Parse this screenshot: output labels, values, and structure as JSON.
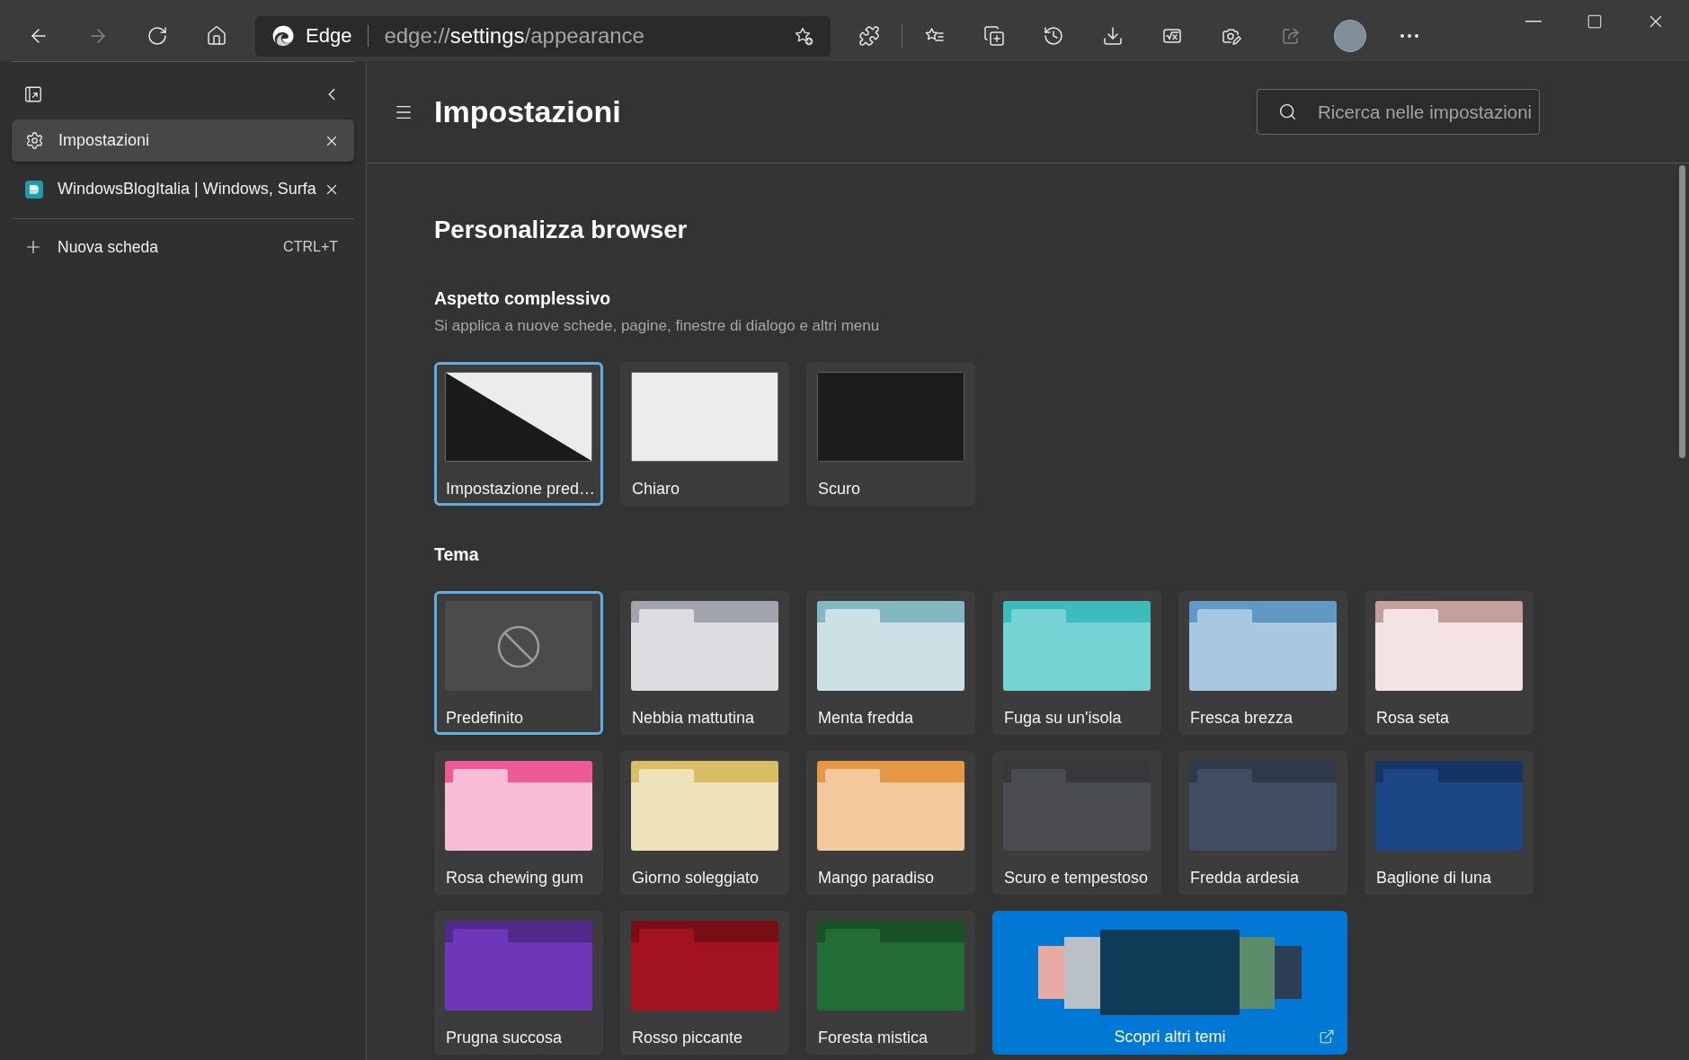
{
  "toolbar": {
    "nav_buttons": [
      {
        "kind": "back",
        "disabled": false
      },
      {
        "kind": "forward",
        "disabled": true
      },
      {
        "kind": "refresh",
        "disabled": false
      },
      {
        "kind": "home",
        "disabled": false
      }
    ],
    "address_bar": {
      "site_label": "Edge",
      "url": {
        "scheme": "edge://",
        "host": "settings",
        "path": "/appearance"
      }
    },
    "button_groups": [
      [
        {
          "kind": "extensions",
          "disabled": false
        }
      ],
      [
        {
          "kind": "favorites",
          "disabled": false
        },
        {
          "kind": "collections",
          "disabled": false
        },
        {
          "kind": "history",
          "disabled": false
        },
        {
          "kind": "downloads",
          "disabled": false
        },
        {
          "kind": "math",
          "disabled": false
        },
        {
          "kind": "capture",
          "disabled": false
        },
        {
          "kind": "share",
          "disabled": true
        },
        {
          "kind": "profile",
          "disabled": false
        },
        {
          "kind": "more",
          "disabled": false
        }
      ]
    ],
    "window_controls": [
      {
        "kind": "minimize"
      },
      {
        "kind": "maximize"
      },
      {
        "kind": "close"
      }
    ]
  },
  "sidebar": {
    "tabs": [
      {
        "kind": "settings",
        "title": "Impostazioni",
        "selected": true
      },
      {
        "kind": "site",
        "title": "WindowsBlogItalia | Windows, Surfa",
        "selected": false
      }
    ],
    "new_tab": {
      "label": "Nuova scheda",
      "shortcut": "CTRL+T"
    }
  },
  "settings": {
    "title": "Impostazioni",
    "search": {
      "placeholder": "Ricerca nelle impostazioni"
    },
    "section_title": "Personalizza browser",
    "appearance": {
      "heading": "Aspetto complessivo",
      "description": "Si applica a nuove schede, pagine, finestre di dialogo e altri menu",
      "options": [
        {
          "kind": "system",
          "label": "Impostazione pred…",
          "selected": true
        },
        {
          "kind": "light",
          "label": "Chiaro",
          "selected": false
        },
        {
          "kind": "dark",
          "label": "Scuro",
          "selected": false
        }
      ]
    },
    "theme": {
      "heading": "Tema",
      "themes": [
        {
          "kind": "none",
          "label": "Predefinito",
          "selected": true
        },
        {
          "kind": "folder",
          "label": "Nebbia mattutina",
          "selected": false,
          "color": "#dcdde0"
        },
        {
          "kind": "folder",
          "label": "Menta fredda",
          "selected": false,
          "color": "#cbe1e5"
        },
        {
          "kind": "folder",
          "label": "Fuga su un'isola",
          "selected": false,
          "color": "#75d3d4"
        },
        {
          "kind": "folder",
          "label": "Fresca brezza",
          "selected": false,
          "color": "#a8c7e0"
        },
        {
          "kind": "folder",
          "label": "Rosa seta",
          "selected": false,
          "color": "#f3e3e2"
        },
        {
          "kind": "folder",
          "label": "Rosa chewing gum",
          "selected": false,
          "color": "#f8bcd5"
        },
        {
          "kind": "folder",
          "label": "Giorno soleggiato",
          "selected": false,
          "color": "#eee2bb"
        },
        {
          "kind": "folder",
          "label": "Mango paradiso",
          "selected": false,
          "color": "#f2c89c"
        },
        {
          "kind": "folder",
          "label": "Scuro e tempestoso",
          "selected": false,
          "color": "#4a4b50"
        },
        {
          "kind": "folder",
          "label": "Fredda ardesia",
          "selected": false,
          "color": "#3f4c62"
        },
        {
          "kind": "folder",
          "label": "Baglione di luna",
          "selected": false,
          "color": "#1b4785"
        },
        {
          "kind": "folder",
          "label": "Prugna succosa",
          "selected": false,
          "color": "#6e37b9"
        },
        {
          "kind": "folder",
          "label": "Rosso piccante",
          "selected": false,
          "color": "#a3131f"
        },
        {
          "kind": "folder",
          "label": "Foresta mistica",
          "selected": false,
          "color": "#216d35"
        }
      ],
      "more_themes": {
        "label": "Scopri altri temi"
      }
    }
  }
}
